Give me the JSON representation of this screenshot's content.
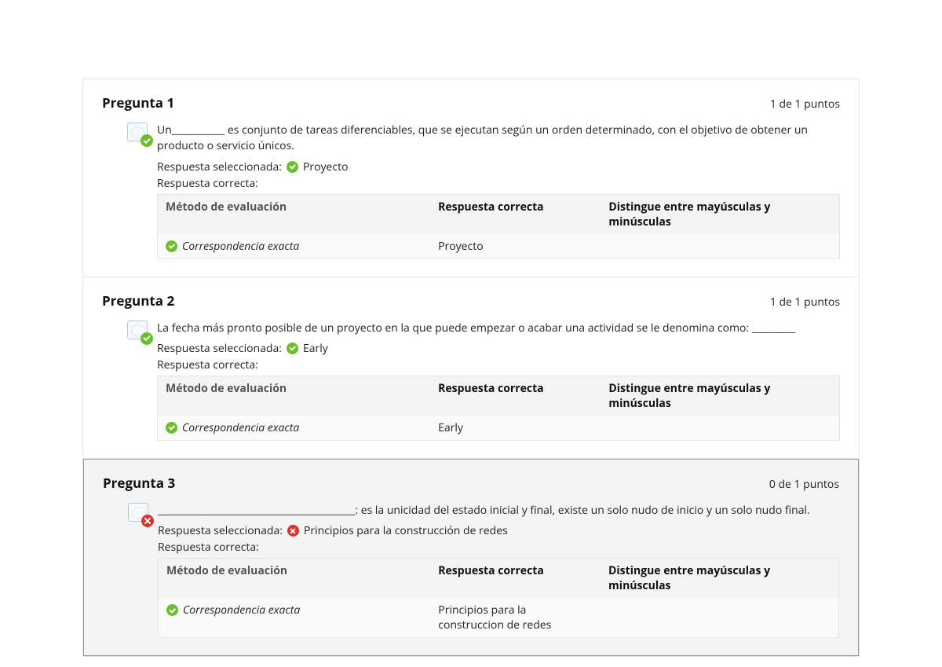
{
  "labels": {
    "selected": "Respuesta seleccionada:",
    "correct": "Respuesta correcta:",
    "table_eval": "Método de evaluación",
    "table_resp": "Respuesta correcta",
    "table_case": "Distingue entre mayúsculas y minúsculas"
  },
  "questions": [
    {
      "title": "Pregunta 1",
      "points": "1 de 1 puntos",
      "correct": true,
      "text": "Un___________ es conjunto de tareas diferenciables, que se ejecutan según un orden determinado, con el objetivo de obtener un producto o servicio únicos.",
      "selected_answer": "Proyecto",
      "selected_correct": true,
      "eval_method": "Correspondencia exacta",
      "eval_answer": "Proyecto",
      "eval_case": ""
    },
    {
      "title": "Pregunta 2",
      "points": "1 de 1 puntos",
      "correct": true,
      "text": "La fecha más pronto posible de un proyecto en la que puede empezar o acabar una actividad se le denomina como: _________",
      "selected_answer": "Early",
      "selected_correct": true,
      "eval_method": "Correspondencia exacta",
      "eval_answer": "Early",
      "eval_case": ""
    },
    {
      "title": "Pregunta 3",
      "points": "0 de 1 puntos",
      "correct": false,
      "text": "_________________________________________: es la unicidad del estado inicial y final, existe un solo nudo de inicio y un solo nudo final.",
      "selected_answer": "Principios para la construcción de redes",
      "selected_correct": false,
      "eval_method": "Correspondencia exacta",
      "eval_answer": "Principios para la construccion de redes",
      "eval_case": ""
    }
  ]
}
